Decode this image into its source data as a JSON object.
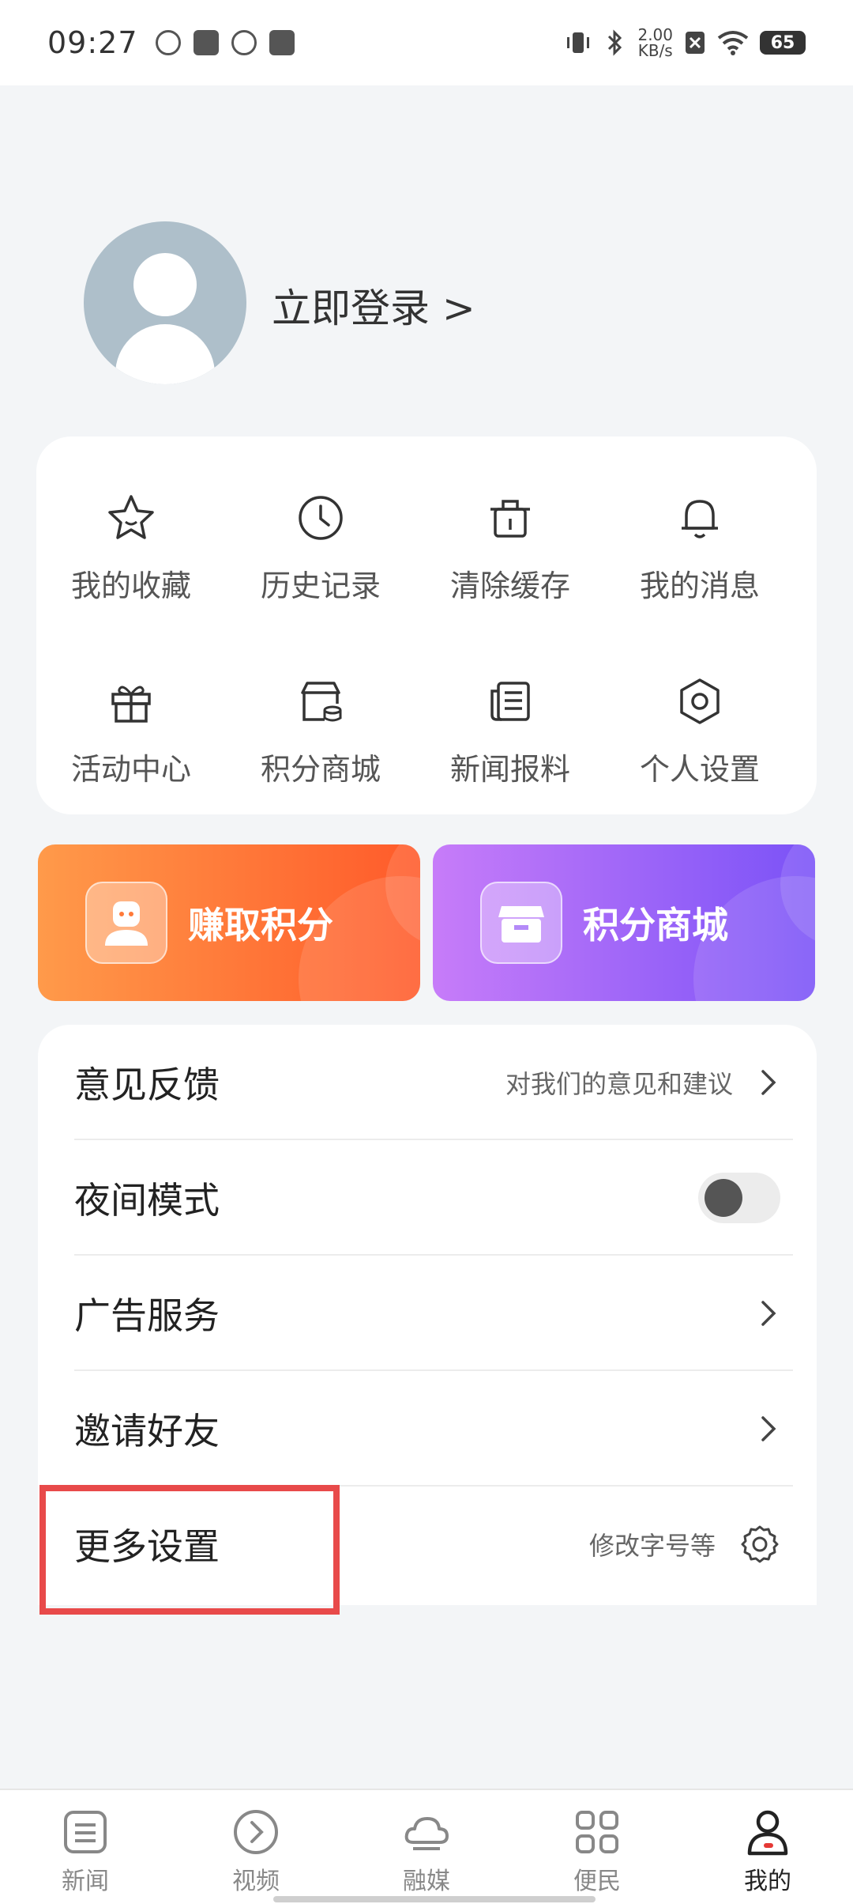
{
  "status_bar": {
    "time": "09:27",
    "net_speed_value": "2.00",
    "net_speed_unit": "KB/s",
    "battery": "65"
  },
  "profile": {
    "login_text": "立即登录 >"
  },
  "grid": [
    {
      "label": "我的收藏",
      "icon": "star-icon"
    },
    {
      "label": "历史记录",
      "icon": "clock-icon"
    },
    {
      "label": "清除缓存",
      "icon": "trash-icon"
    },
    {
      "label": "我的消息",
      "icon": "bell-icon"
    },
    {
      "label": "活动中心",
      "icon": "gift-icon"
    },
    {
      "label": "积分商城",
      "icon": "store-icon"
    },
    {
      "label": "新闻报料",
      "icon": "news-icon"
    },
    {
      "label": "个人设置",
      "icon": "hexagon-settings-icon"
    }
  ],
  "promos": {
    "earn_points": "赚取积分",
    "points_mall": "积分商城"
  },
  "list": {
    "feedback": {
      "title": "意见反馈",
      "hint": "对我们的意见和建议"
    },
    "night_mode": {
      "title": "夜间模式",
      "enabled": false
    },
    "ad_service": {
      "title": "广告服务"
    },
    "invite": {
      "title": "邀请好友"
    },
    "more_settings": {
      "title": "更多设置",
      "hint": "修改字号等"
    }
  },
  "bottom_nav": [
    {
      "label": "新闻",
      "icon": "news-icon"
    },
    {
      "label": "视频",
      "icon": "play-icon"
    },
    {
      "label": "融媒",
      "icon": "cloud-icon"
    },
    {
      "label": "便民",
      "icon": "grid-icon"
    },
    {
      "label": "我的",
      "icon": "person-icon",
      "active": true
    }
  ],
  "colors": {
    "highlight": "#e84a4a",
    "promo_orange": "#ff6a33",
    "promo_purple": "#8a5cf7"
  }
}
